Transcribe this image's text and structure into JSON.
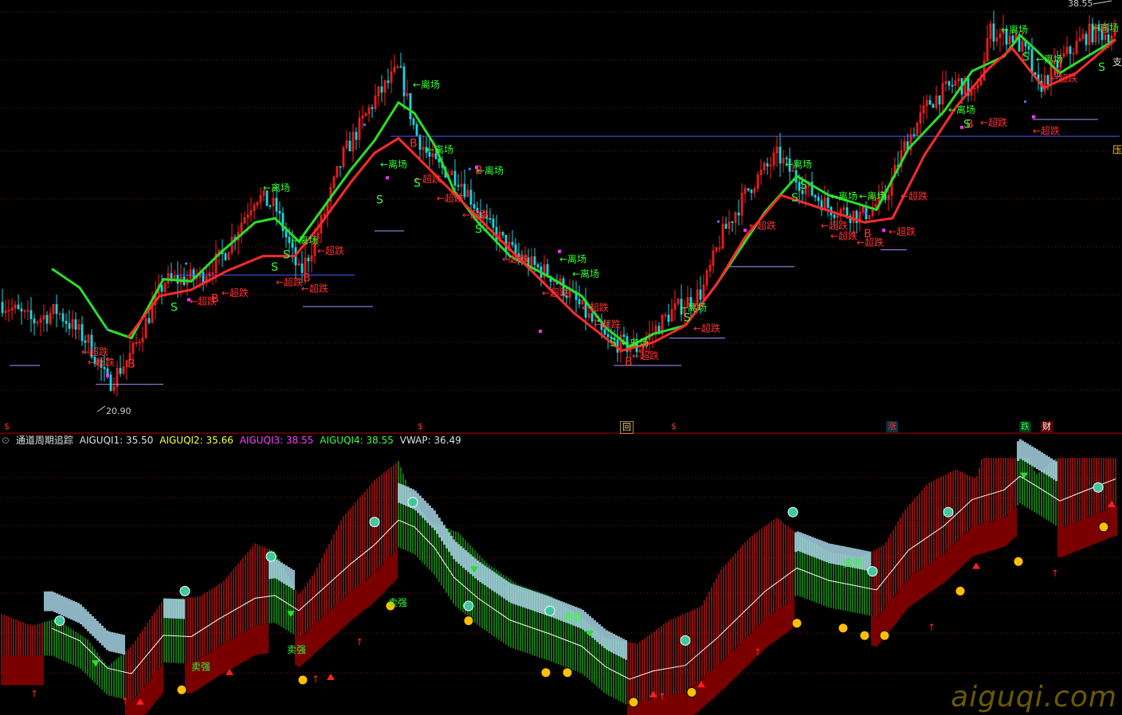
{
  "colors": {
    "background": "#000000",
    "grid": "#7a1010",
    "up": "#ff2020",
    "down": "#16d8e0",
    "green_line": "#28e028",
    "red_line": "#ff2a2a",
    "blue_line": "#4a5cff",
    "violet_line": "#a89cff",
    "magenta": "#ff30ff",
    "label_red": "#ff3030",
    "label_green": "#30ff30",
    "cloud": "#a6d2e3",
    "dark_red": "#7a0000",
    "circle_orange": "#ffc000",
    "circle_teal": "#40c8a0",
    "watermark": "#6b5a00"
  },
  "price_labels": {
    "high": "38.55",
    "low": "20.90",
    "right_res": "压",
    "right_sup": "支"
  },
  "labels": {
    "exit": "离场",
    "over": "超跌",
    "buy": "B",
    "sell": "S",
    "exit_arrow": "←离场",
    "over_arrow": "←超跌"
  },
  "signal_boxes": [
    {
      "text": "$",
      "fg": "#ff3030",
      "bg": "#000000"
    },
    {
      "text": "$",
      "fg": "#ff3030",
      "bg": "#000000"
    },
    {
      "text": "回",
      "fg": "#ffcc66",
      "bg": "#332200"
    },
    {
      "text": "$",
      "fg": "#ff3030",
      "bg": "#000000"
    },
    {
      "text": "涨",
      "fg": "#ff3030",
      "bg": "#003344"
    },
    {
      "text": "跌",
      "fg": "#30ff30",
      "bg": "#003322"
    },
    {
      "text": "财",
      "fg": "#ffffff",
      "bg": "#660000"
    }
  ],
  "indicator": {
    "name": "通道周期追踪",
    "items": [
      {
        "label": "AIGUQI1: 35.50",
        "color": "#e0e0e0"
      },
      {
        "label": "AIGUQI2: 35.66",
        "color": "#ffff40"
      },
      {
        "label": "AIGUQI3: 38.55",
        "color": "#ff40ff"
      },
      {
        "label": "AIGUQI4: 38.55",
        "color": "#40ff40"
      },
      {
        "label": "VWAP: 36.49",
        "color": "#e0e0e0"
      }
    ],
    "text_labels": [
      "卖强",
      "卖强",
      "卖弱",
      "卖强",
      "卖强"
    ]
  },
  "chart_data": {
    "type": "candlestick",
    "title": "",
    "ylim": [
      20.0,
      39.5
    ],
    "price_anchor_points": [
      [
        0,
        25.5
      ],
      [
        40,
        24.6
      ],
      [
        70,
        25.1
      ],
      [
        110,
        23.6
      ],
      [
        135,
        21.6
      ],
      [
        165,
        23.1
      ],
      [
        205,
        26.5
      ],
      [
        250,
        26.7
      ],
      [
        280,
        27.8
      ],
      [
        320,
        30.6
      ],
      [
        345,
        30.0
      ],
      [
        375,
        26.8
      ],
      [
        395,
        28.5
      ],
      [
        430,
        32.5
      ],
      [
        470,
        35.2
      ],
      [
        500,
        36.6
      ],
      [
        520,
        33.6
      ],
      [
        540,
        32.2
      ],
      [
        575,
        31.4
      ],
      [
        610,
        29.2
      ],
      [
        650,
        27.6
      ],
      [
        690,
        26.8
      ],
      [
        725,
        25.4
      ],
      [
        760,
        23.7
      ],
      [
        800,
        23.3
      ],
      [
        840,
        25.0
      ],
      [
        880,
        26.0
      ],
      [
        905,
        28.7
      ],
      [
        940,
        31.0
      ],
      [
        975,
        32.5
      ],
      [
        1000,
        31.3
      ],
      [
        1040,
        30.0
      ],
      [
        1080,
        29.6
      ],
      [
        1110,
        30.5
      ],
      [
        1135,
        33.0
      ],
      [
        1165,
        35.0
      ],
      [
        1200,
        36.0
      ],
      [
        1225,
        35.3
      ],
      [
        1240,
        38.4
      ],
      [
        1270,
        38.1
      ],
      [
        1290,
        37.2
      ],
      [
        1300,
        35.6
      ],
      [
        1330,
        37.0
      ],
      [
        1365,
        38.3
      ],
      [
        1400,
        38.3
      ]
    ],
    "green_channel": [
      [
        65,
        27.1
      ],
      [
        100,
        26.2
      ],
      [
        135,
        24.2
      ],
      [
        165,
        23.8
      ],
      [
        205,
        26.6
      ],
      [
        240,
        26.5
      ],
      [
        275,
        27.8
      ],
      [
        320,
        29.3
      ],
      [
        345,
        29.5
      ],
      [
        375,
        28.4
      ],
      [
        440,
        31.8
      ],
      [
        470,
        33.2
      ],
      [
        500,
        35.0
      ],
      [
        520,
        34.5
      ],
      [
        545,
        33.0
      ],
      [
        570,
        30.8
      ],
      [
        600,
        29.3
      ],
      [
        640,
        27.7
      ],
      [
        690,
        26.7
      ],
      [
        730,
        25.8
      ],
      [
        760,
        24.3
      ],
      [
        790,
        23.4
      ],
      [
        820,
        24.0
      ],
      [
        860,
        24.4
      ],
      [
        900,
        26.4
      ],
      [
        960,
        29.8
      ],
      [
        1000,
        31.5
      ],
      [
        1040,
        30.6
      ],
      [
        1075,
        30.2
      ],
      [
        1100,
        29.9
      ],
      [
        1140,
        32.8
      ],
      [
        1185,
        34.6
      ],
      [
        1220,
        36.5
      ],
      [
        1260,
        37.2
      ],
      [
        1280,
        38.2
      ],
      [
        1300,
        37.5
      ],
      [
        1330,
        36.4
      ],
      [
        1360,
        37.1
      ],
      [
        1400,
        38.0
      ]
    ],
    "red_channel": [
      [
        160,
        23.8
      ],
      [
        200,
        25.8
      ],
      [
        240,
        26.1
      ],
      [
        285,
        27.0
      ],
      [
        330,
        27.7
      ],
      [
        370,
        27.7
      ],
      [
        400,
        29.1
      ],
      [
        440,
        31.2
      ],
      [
        470,
        32.6
      ],
      [
        500,
        33.3
      ],
      [
        720,
        25.0
      ],
      [
        780,
        23.2
      ],
      [
        820,
        23.6
      ],
      [
        860,
        24.4
      ],
      [
        900,
        26.4
      ],
      [
        935,
        28.6
      ],
      [
        980,
        30.6
      ],
      [
        1085,
        29.3
      ],
      [
        1120,
        29.5
      ],
      [
        1160,
        32.5
      ],
      [
        1200,
        34.8
      ],
      [
        1240,
        36.6
      ],
      [
        1270,
        37.6
      ],
      [
        1310,
        35.7
      ],
      [
        1350,
        36.4
      ],
      [
        1400,
        38.0
      ]
    ],
    "price_lines": [
      {
        "x1": 490,
        "x2": 1405,
        "y": 33.4,
        "color": "#4a5cff"
      },
      {
        "x1": 220,
        "x2": 445,
        "y": 26.8,
        "color": "#4a5cff"
      },
      {
        "x1": 12,
        "x2": 50,
        "y": 22.5,
        "color": "#a89cff"
      },
      {
        "x1": 120,
        "x2": 205,
        "y": 21.6,
        "color": "#a89cff"
      },
      {
        "x1": 380,
        "x2": 468,
        "y": 25.3,
        "color": "#a89cff"
      },
      {
        "x1": 470,
        "x2": 507,
        "y": 28.9,
        "color": "#a89cff"
      },
      {
        "x1": 912,
        "x2": 997,
        "y": 27.2,
        "color": "#a89cff"
      },
      {
        "x1": 1105,
        "x2": 1138,
        "y": 28.0,
        "color": "#a89cff"
      },
      {
        "x1": 1296,
        "x2": 1378,
        "y": 34.2,
        "color": "#a89cff"
      },
      {
        "x1": 840,
        "x2": 910,
        "y": 23.8,
        "color": "#a89cff"
      },
      {
        "x1": 770,
        "x2": 855,
        "y": 22.5,
        "color": "#a89cff"
      }
    ],
    "exit_labels": [
      [
        330,
        30.8
      ],
      [
        365,
        28.3
      ],
      [
        477,
        31.9
      ],
      [
        518,
        35.7
      ],
      [
        535,
        32.6
      ],
      [
        598,
        31.6
      ],
      [
        702,
        27.4
      ],
      [
        718,
        26.7
      ],
      [
        780,
        23.4
      ],
      [
        853,
        25.1
      ],
      [
        985,
        31.9
      ],
      [
        1042,
        30.4
      ],
      [
        1078,
        30.4
      ],
      [
        1190,
        34.5
      ],
      [
        1256,
        38.3
      ],
      [
        1300,
        36.9
      ],
      [
        1370,
        38.4
      ]
    ],
    "over_labels": [
      [
        102,
        23.0
      ],
      [
        110,
        22.5
      ],
      [
        238,
        25.4
      ],
      [
        278,
        25.8
      ],
      [
        346,
        26.3
      ],
      [
        378,
        26.0
      ],
      [
        398,
        27.8
      ],
      [
        520,
        31.2
      ],
      [
        548,
        30.3
      ],
      [
        580,
        29.5
      ],
      [
        630,
        27.4
      ],
      [
        680,
        25.8
      ],
      [
        730,
        25.1
      ],
      [
        745,
        24.3
      ],
      [
        793,
        22.8
      ],
      [
        870,
        24.1
      ],
      [
        940,
        29.0
      ],
      [
        1030,
        29.0
      ],
      [
        1042,
        28.5
      ],
      [
        1075,
        28.2
      ],
      [
        1115,
        28.7
      ],
      [
        1130,
        30.4
      ],
      [
        1230,
        33.9
      ],
      [
        1296,
        33.5
      ],
      [
        1318,
        36.0
      ]
    ],
    "buy_marks": [
      [
        160,
        22.4
      ],
      [
        265,
        25.5
      ],
      [
        380,
        26.5
      ],
      [
        514,
        32.9
      ],
      [
        596,
        31.6
      ],
      [
        784,
        22.5
      ],
      [
        1084,
        28.6
      ],
      [
        1212,
        33.8
      ],
      [
        1322,
        36.2
      ],
      [
        1382,
        38.3
      ]
    ],
    "sell_marks": [
      [
        214,
        25.1
      ],
      [
        340,
        27.0
      ],
      [
        355,
        27.6
      ],
      [
        472,
        30.2
      ],
      [
        519,
        31.0
      ],
      [
        596,
        28.8
      ],
      [
        765,
        23.4
      ],
      [
        858,
        24.6
      ],
      [
        993,
        30.3
      ],
      [
        1004,
        30.9
      ],
      [
        1209,
        33.8
      ],
      [
        1283,
        37.0
      ],
      [
        1378,
        36.5
      ]
    ],
    "low_label": "20.90",
    "high_label": "38.55",
    "indicator_ylim": [
      0,
      100
    ]
  }
}
